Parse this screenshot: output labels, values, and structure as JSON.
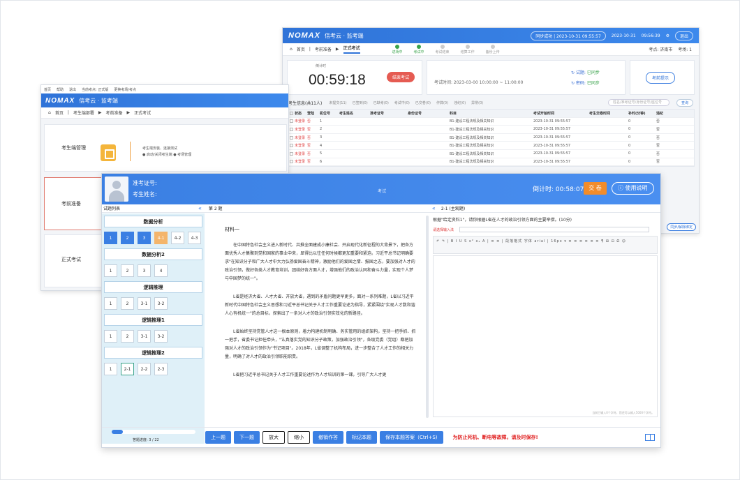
{
  "w1": {
    "brand": "NOMAX",
    "sub": "信考云 · 监考端",
    "pill": "同步成功 | 2023-10-31 09:55:57",
    "date": "2023-10-31",
    "time": "09:56:39",
    "logout": "退出",
    "crumb": [
      "首页",
      "考前准备",
      "正式考试"
    ],
    "steps": [
      "进场中",
      "考试中",
      "考试结束",
      "结算工作",
      "备份上传"
    ],
    "right_info": [
      "考点: 济南市",
      "考场: 1"
    ],
    "timer_label": "倒计时",
    "timer": "00:59:18",
    "end_btn": "结束考试",
    "exam_time": "考试时间:  2023-03-00 10:00:00 ~ 11:00:00",
    "sync1": "试题:",
    "sync1_val": "已同步",
    "sync2": "密码:",
    "sync2_val": "已同步",
    "notice_btn": "考前提示",
    "filter_title": "考生信息(共11人)",
    "filter_opts": [
      "未提交(11)",
      "已签到(0)",
      "已缺考(0)",
      "考试中(0)",
      "已交卷(0)",
      "作弊(0)",
      "违纪(0)",
      "异常(0)"
    ],
    "search_ph": "姓名/准考证号/身份证号/座位号",
    "search_btn": "查询",
    "headers": [
      "",
      "状态",
      "登陆",
      "机位号",
      "考生姓名",
      "准考证号",
      "身份证号",
      "科目",
      "考试开始时间",
      "考生交卷时间",
      "补时(分钟)",
      "违纪"
    ],
    "rows": [
      {
        "status": "未登录",
        "login": "否",
        "seat": "1",
        "subject": "B1-建设工程法规及相关知识",
        "start": "2023-10-31 09:55:57",
        "extra": "0",
        "v": "否"
      },
      {
        "status": "未登录",
        "login": "否",
        "seat": "2",
        "subject": "B1-建设工程法规及相关知识",
        "start": "2023-10-31 09:55:57",
        "extra": "0",
        "v": "否"
      },
      {
        "status": "未登录",
        "login": "否",
        "seat": "3",
        "subject": "B1-建设工程法规及相关知识",
        "start": "2023-10-31 09:55:57",
        "extra": "0",
        "v": "否"
      },
      {
        "status": "未登录",
        "login": "否",
        "seat": "4",
        "subject": "B1-建设工程法规及相关知识",
        "start": "2023-10-31 09:55:57",
        "extra": "0",
        "v": "否"
      },
      {
        "status": "未登录",
        "login": "否",
        "seat": "5",
        "subject": "B1-建设工程法规及相关知识",
        "start": "2023-10-31 09:55:57",
        "extra": "0",
        "v": "否"
      },
      {
        "status": "未登录",
        "login": "否",
        "seat": "6",
        "subject": "B1-建设工程法规及相关知识",
        "start": "2023-10-31 09:55:57",
        "extra": "0",
        "v": "否"
      }
    ],
    "side_btn": "同步/解除绑定"
  },
  "w2": {
    "top_items": [
      "首页",
      "帮助",
      "退出",
      "当前考点: 正式版",
      "更换考场/考点"
    ],
    "brand": "NOMAX",
    "sub": "信考云 · 监考端",
    "crumb": [
      "首页",
      "考生端部署",
      "考前准备",
      "正式考试"
    ],
    "panel1": "考生端管理",
    "panel1_desc1": "考生端安装、连接测试",
    "panel1_desc2": "● 启动/关闭考生端   ● 考场管理",
    "panel2": "考前准备",
    "panel3": "正式考试"
  },
  "w3": {
    "ticket_label": "准考证号:",
    "name_label": "考生姓名:",
    "mid": "考试",
    "countdown_label": "倒计时:",
    "countdown": "00:58:07",
    "submit": "交 卷",
    "help": "使用说明",
    "sub_left": "试题列表",
    "sub_mid": "第 2 题",
    "sub_right": "2-1 (主观题)",
    "sections": [
      {
        "title": "数据分析",
        "qs": [
          {
            "n": "1",
            "s": "done"
          },
          {
            "n": "2",
            "s": "done"
          },
          {
            "n": "3",
            "s": "done"
          },
          {
            "n": "4-1",
            "s": "mark"
          },
          {
            "n": "4-2",
            "s": ""
          },
          {
            "n": "4-3",
            "s": ""
          }
        ]
      },
      {
        "title": "数据分析2",
        "qs": [
          {
            "n": "1",
            "s": ""
          },
          {
            "n": "2",
            "s": ""
          },
          {
            "n": "3",
            "s": ""
          },
          {
            "n": "4",
            "s": ""
          }
        ]
      },
      {
        "title": "逻辑推理",
        "qs": [
          {
            "n": "1",
            "s": ""
          },
          {
            "n": "2",
            "s": ""
          },
          {
            "n": "3-1",
            "s": ""
          },
          {
            "n": "3-2",
            "s": ""
          }
        ]
      },
      {
        "title": "逻辑推理1",
        "qs": [
          {
            "n": "1",
            "s": ""
          },
          {
            "n": "2",
            "s": ""
          },
          {
            "n": "3-1",
            "s": ""
          },
          {
            "n": "3-2",
            "s": ""
          }
        ]
      },
      {
        "title": "逻辑推理2",
        "qs": [
          {
            "n": "1",
            "s": ""
          },
          {
            "n": "2-1",
            "s": "cur"
          },
          {
            "n": "2-2",
            "s": ""
          },
          {
            "n": "2-3",
            "s": ""
          }
        ]
      }
    ],
    "progress_label": "答题进度: 3 / 22",
    "progress_fraction": 0.136,
    "material_title": "材料一",
    "material": [
      "在中国特色社会主义进入新时代、共推全面建成小康社会、开启现代化新征程的大背景下，把各方面优秀人才集聚到党和国家的事业中来，显得比以往任何时候都更加重要和紧迫。习近平总书记明确要求\"在知识分子和广大人才中大力弘扬爱国奋斗精神，激励他们的爱国之情、报国之志，要加强对人才的政治引领，做好各类人才教育培训，团结好各方面人才，增强他们的政治认同和奋斗力量，实现个人梦与中国梦的统一\"。",
      "L省是经济大省、人才大省、开放大省，遇到的矛盾问题更早更多，面对一系列难题，L省以习近平新时代中国特色社会主义思想和习近平总书记关于人才工作重要论述为指导，紧紧围绕\"实现人才数和谐人心有机统一\"的总目标，探索出了一条对人才的政治引领实效化的新路径。",
      "L省始终坚持党管人才这一根本原则，着力构建机制明确、务实管用的组织架构，坚持一把手抓、抓一把手，省委书记担任牵头，\"认真落实党的知识分子政策，加强政治引领\"，各级党委（党组）都把加强对人才的政治引领作为\"书记项目\"。2018年，L省调整了机构布局，进一步整合了人才工作的相关力量，明确了对人才的政治引领职能职责。",
      "L省把习近平总书记关于人才工作重要论述作为人才培训的第一课，引导广大人才更"
    ],
    "question": "根据\"给定资料1\"，请你根据L省在人才的政治引领方面的主要举措。(10分)",
    "editor_label": "请选择输入法",
    "tools": "↶ ↷ | B I U S x² x₂ A | ≡ ≡ | 段落格式 字体 arial | 16px ▾ ≡ ≡ ≡ ≡ ≡ ≡ ¶ ⊞ ⊟ Ω ☺",
    "editor_hint": "当前已输入0个字符，您还可以输入5000个字符。",
    "btn_prev": "上一题",
    "btn_next": "下一题",
    "btn_zoom_in": "放大",
    "btn_zoom_out": "缩小",
    "btn_undo": "撤销作答",
    "btn_mark": "标记本题",
    "btn_save": "保存本题答案（Ctrl+S)",
    "warning": "为防止死机、断电等故障，请及时保存!"
  }
}
